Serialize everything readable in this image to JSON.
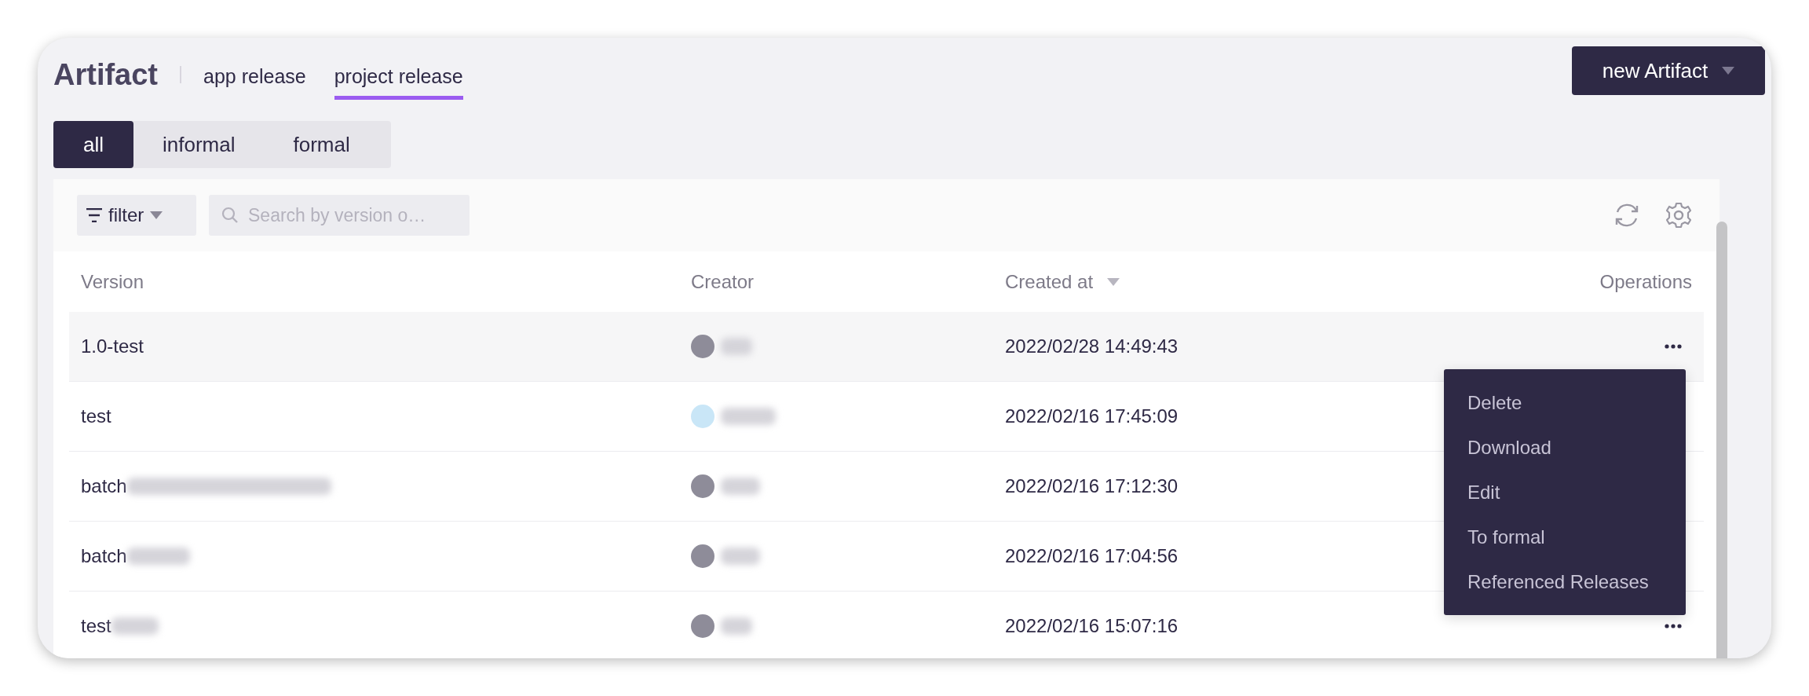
{
  "header": {
    "title": "Artifact",
    "tabs": [
      {
        "label": "app release",
        "selected": false
      },
      {
        "label": "project release",
        "selected": true
      }
    ],
    "new_button": "new Artifact"
  },
  "segments": [
    {
      "label": "all",
      "selected": true
    },
    {
      "label": "informal",
      "selected": false
    },
    {
      "label": "formal",
      "selected": false
    }
  ],
  "toolbar": {
    "filter": "filter",
    "search": {
      "placeholder": "Search by version o…"
    }
  },
  "table": {
    "columns": [
      {
        "label": "Version",
        "sorted": false
      },
      {
        "label": "Creator",
        "sorted": false
      },
      {
        "label": "Created at",
        "sorted": true
      },
      {
        "label": "Operations",
        "sorted": false
      }
    ],
    "rows": [
      {
        "version": "1.0-test",
        "redacted": false,
        "creator": {
          "color": "#8e8c99"
        },
        "created": "2022/02/28 14:49:43",
        "hovered": true,
        "actions": true
      },
      {
        "version": "test",
        "redacted": false,
        "creator": {
          "color": "#c9e6f7"
        },
        "created": "2022/02/16 17:45:09",
        "hovered": false,
        "actions": false
      },
      {
        "version": "batch",
        "redacted": true,
        "creator": {
          "color": "#8e8c99"
        },
        "created": "2022/02/16 17:12:30",
        "hovered": false,
        "actions": false
      },
      {
        "version": "batch",
        "redacted": true,
        "creator": {
          "color": "#8e8c99"
        },
        "created": "2022/02/16 17:04:56",
        "hovered": false,
        "actions": false
      },
      {
        "version": "test",
        "redacted": true,
        "creator": {
          "color": "#8e8c99"
        },
        "created": "2022/02/16 15:07:16",
        "hovered": false,
        "actions": true
      }
    ]
  },
  "menu": {
    "items": [
      "Delete",
      "Download",
      "Edit",
      "To formal",
      "Referenced Releases"
    ]
  }
}
